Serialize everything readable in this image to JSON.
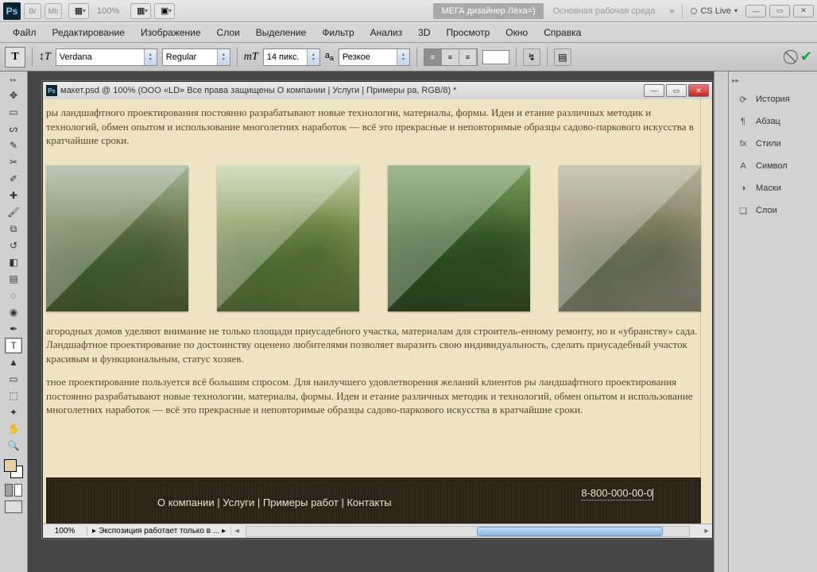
{
  "app_bar": {
    "ps": "Ps",
    "zoom": "100%",
    "mega": "МЕГА дизайнер Лёха=)",
    "workspace": "Основная рабочая среда",
    "chev": "»",
    "cslive": "CS Live"
  },
  "menu": [
    "Файл",
    "Редактирование",
    "Изображение",
    "Слои",
    "Выделение",
    "Фильтр",
    "Анализ",
    "3D",
    "Просмотр",
    "Окно",
    "Справка"
  ],
  "opts": {
    "font_family": "Verdana",
    "font_style": "Regular",
    "font_size": "14 пикс.",
    "aa": "Резкое"
  },
  "doc": {
    "title": "макет.psd @ 100% (ООО «LD»  Все права защищены     О компании | Услуги | Примеры ра, RGB/8) *",
    "p1": "ры ландшафтного проектирования постоянно разрабатывают новые технологии, материалы, формы. Идеи и етание различных методик и технологий, обмен опытом и использование многолетних наработок — всё это прекрасные и неповторимые образцы садово-паркового искусства в кратчайшие сроки.",
    "p2": "агородных домов уделяют внимание не только площади приусадебного участка, материалам для строитель-енному ремонту, но и «убранству» сада. Ландшафтное проектирование по достоинству оценено любителями позволяет выразить свою индивидуальность, сделать приусадебный участок красивым и функциональным, статус хозяев.",
    "p3": "тное проектирование пользуется всё большим спросом. Для наилучшего удовлетворения желаний клиентов ры ландшафтного проектирования постоянно разрабатывают новые технологии, материалы, формы. Идеи и етание различных методик и технологий, обмен опытом и использование многолетних наработок — всё это прекрасные и неповторимые образцы садово-паркового искусства в кратчайшие сроки.",
    "footer_nav": "О компании | Услуги | Примеры работ | Контакты",
    "phone": "8-800-000-00-0"
  },
  "status": {
    "zoom": "100%",
    "info": "Экспозиция работает только в ..."
  },
  "panels": [
    "История",
    "Абзац",
    "Стили",
    "Символ",
    "Маски",
    "Слои"
  ]
}
